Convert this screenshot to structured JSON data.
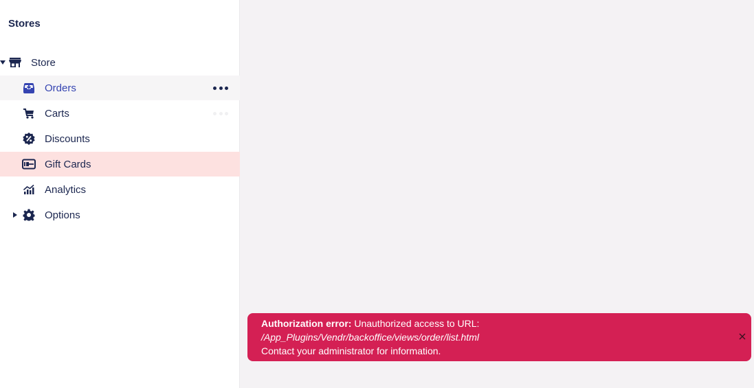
{
  "sidebar": {
    "title": "Stores",
    "root": {
      "label": "Store",
      "icon": "store-icon",
      "expanded": true
    },
    "items": [
      {
        "label": "Orders",
        "icon": "inbox-download-icon",
        "state": "hover"
      },
      {
        "label": "Carts",
        "icon": "cart-icon",
        "state": "normal"
      },
      {
        "label": "Discounts",
        "icon": "discount-badge-icon",
        "state": "normal"
      },
      {
        "label": "Gift Cards",
        "icon": "gift-card-icon",
        "state": "selected"
      },
      {
        "label": "Analytics",
        "icon": "analytics-chart-icon",
        "state": "normal"
      },
      {
        "label": "Options",
        "icon": "gear-icon",
        "state": "collapsed"
      }
    ]
  },
  "toast": {
    "title": "Authorization error:",
    "message": " Unauthorized access to URL:",
    "url": "/App_Plugins/Vendr/backoffice/views/order/list.html",
    "footer": "Contact your administrator for information.",
    "close_icon": "close-icon",
    "color": "#d42054"
  },
  "colors": {
    "sidebar_bg": "#ffffff",
    "main_bg": "#f4f2f4",
    "selected_bg": "#fde1e0",
    "text": "#1b264f",
    "link": "#3544b1"
  }
}
